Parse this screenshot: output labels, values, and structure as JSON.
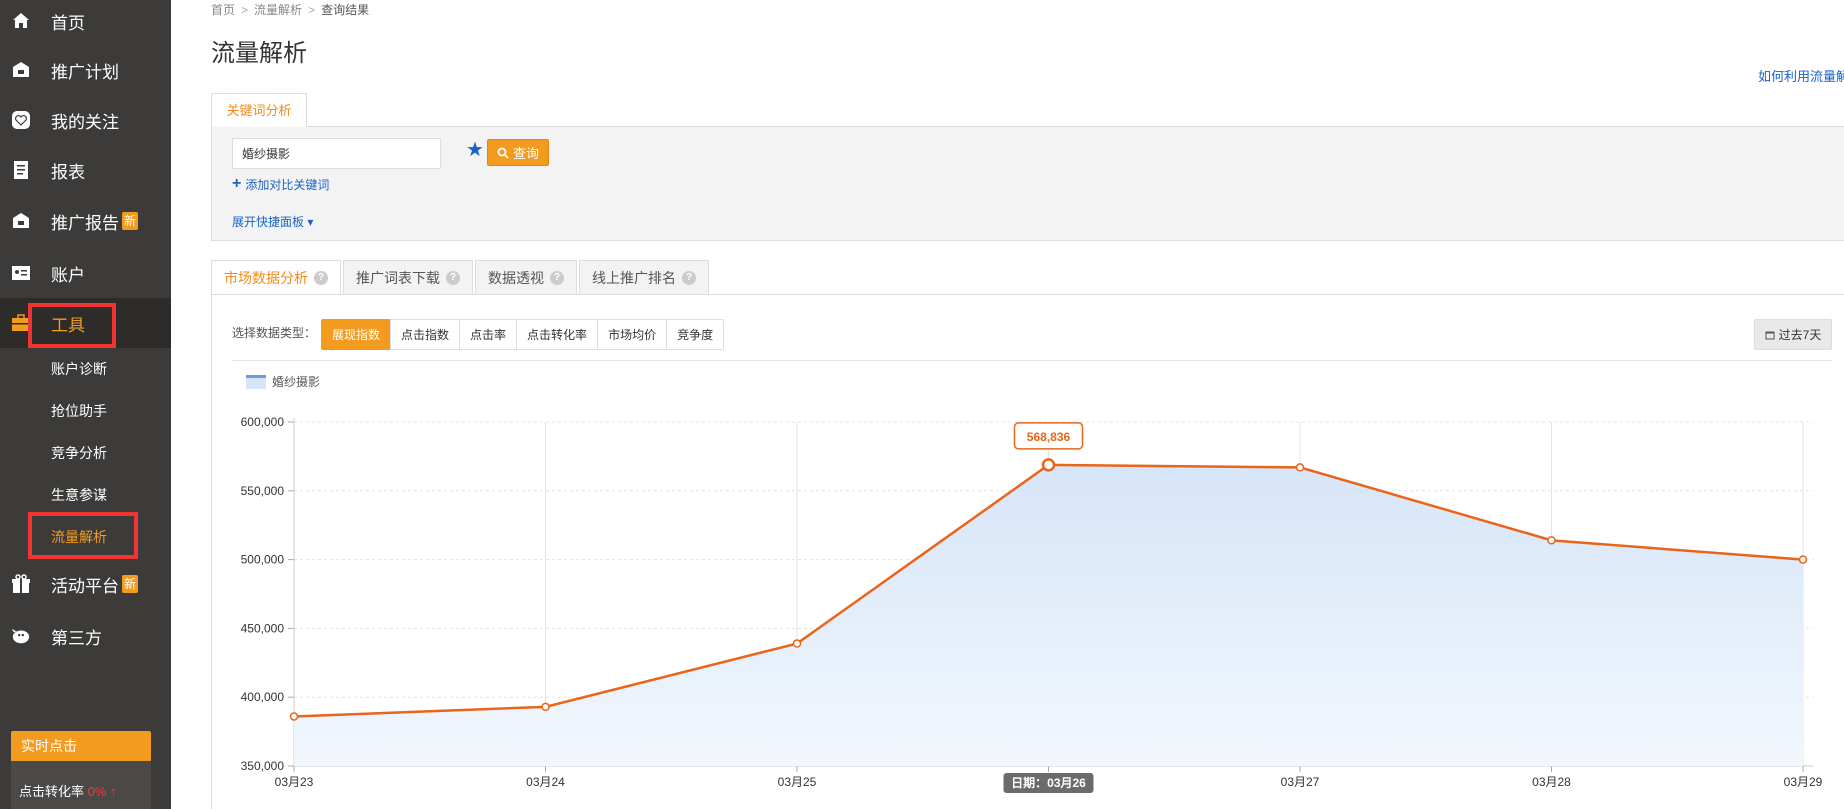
{
  "sidebar": {
    "items": [
      {
        "label": "首页",
        "icon": "home-icon"
      },
      {
        "label": "推广计划",
        "icon": "plan-icon"
      },
      {
        "label": "我的关注",
        "icon": "heart-icon"
      },
      {
        "label": "报表",
        "icon": "report-icon"
      },
      {
        "label": "推广报告",
        "icon": "bag-icon",
        "badge": "新"
      },
      {
        "label": "账户",
        "icon": "account-icon"
      },
      {
        "label": "工具",
        "icon": "toolbox-icon"
      },
      {
        "label": "活动平台",
        "icon": "gift-icon",
        "badge": "新"
      },
      {
        "label": "第三方",
        "icon": "bird-icon"
      }
    ],
    "sub_items": [
      "账户诊断",
      "抢位助手",
      "竞争分析",
      "生意参谋",
      "流量解析"
    ],
    "realtime": {
      "header": "实时点击",
      "label": "点击转化率",
      "value": "0%",
      "arrow": "↑"
    }
  },
  "breadcrumb": [
    "首页",
    "流量解析",
    "查询结果"
  ],
  "page_title": "流量解析",
  "help_link": "如何利用流量解析",
  "keyword_tab": "关键词分析",
  "search": {
    "value": "婚纱摄影",
    "button_label": "查询"
  },
  "add_compare": "添加对比关键词",
  "expand_panel": "展开快捷面板",
  "analysis_tabs": [
    "市场数据分析",
    "推广词表下载",
    "数据透视",
    "线上推广排名"
  ],
  "data_type": {
    "label": "选择数据类型：",
    "options": [
      "展现指数",
      "点击指数",
      "点击率",
      "点击转化率",
      "市场均价",
      "竞争度"
    ],
    "selected": "展现指数"
  },
  "range_button": "过去7天",
  "colors": {
    "accent": "#f39b1f",
    "line": "#e8651a",
    "area": "#d6e5f8",
    "link": "#1a62c7",
    "highlight": "#ee3434"
  },
  "chart_data": {
    "type": "area",
    "x": [
      "03月23",
      "03月24",
      "03月25",
      "03月26",
      "03月27",
      "03月28",
      "03月29"
    ],
    "series": [
      {
        "name": "婚纱摄影",
        "values": [
          386000,
          393000,
          439000,
          568836,
          567000,
          514000,
          500000
        ]
      }
    ],
    "ylim": [
      350000,
      600000
    ],
    "yticks": [
      "350,000",
      "400,000",
      "450,000",
      "500,000",
      "550,000",
      "600,000"
    ],
    "tooltip": {
      "value": "568,836",
      "x_label": "日期：03月26"
    },
    "grid": true
  }
}
